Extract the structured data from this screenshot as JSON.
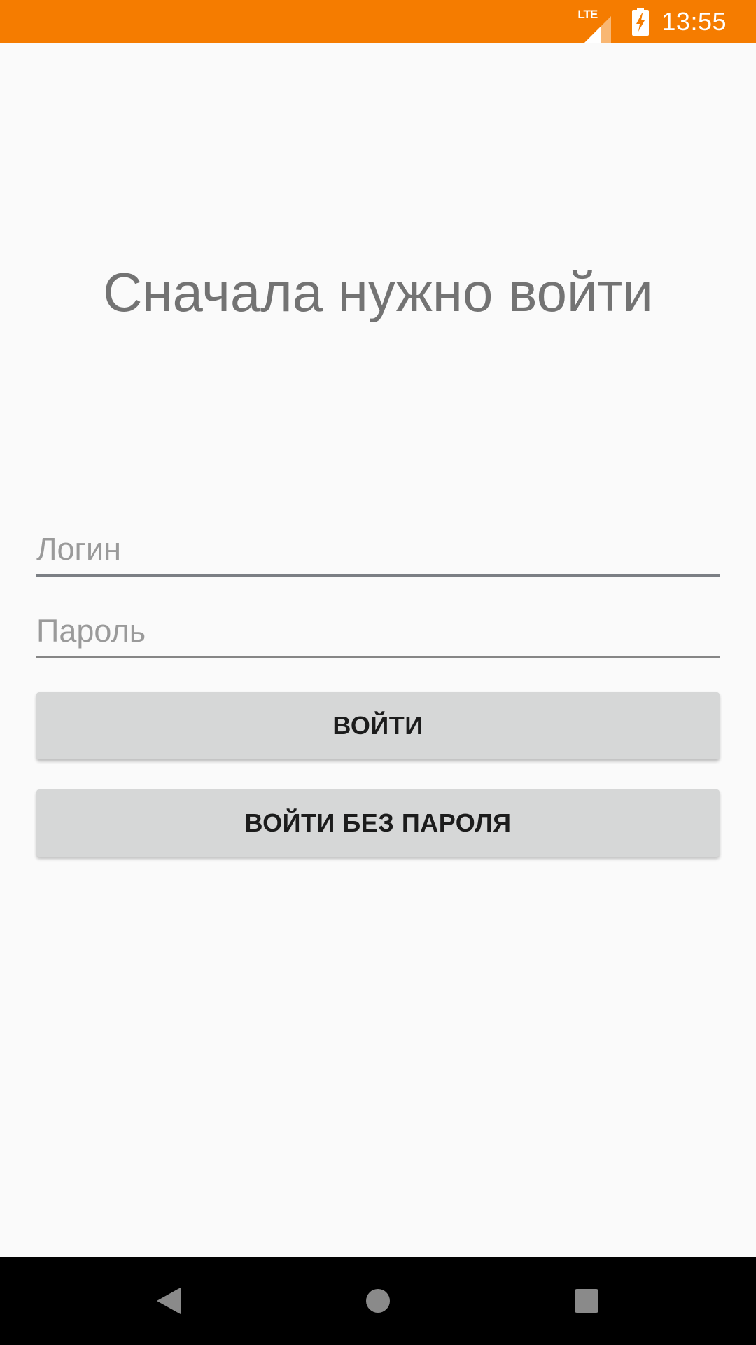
{
  "status_bar": {
    "network_label": "LTE",
    "time": "13:55",
    "background_color": "#f57c00",
    "icons": [
      "lte-signal-icon",
      "battery-charging-icon"
    ]
  },
  "main": {
    "headline": "Сначала нужно войти",
    "login_field": {
      "placeholder": "Логин",
      "value": ""
    },
    "password_field": {
      "placeholder": "Пароль",
      "value": ""
    },
    "login_button_label": "ВОЙТИ",
    "passwordless_button_label": "ВОЙТИ БЕЗ ПАРОЛЯ"
  },
  "nav_bar": {
    "icons": [
      "back-icon",
      "home-icon",
      "recents-icon"
    ]
  }
}
